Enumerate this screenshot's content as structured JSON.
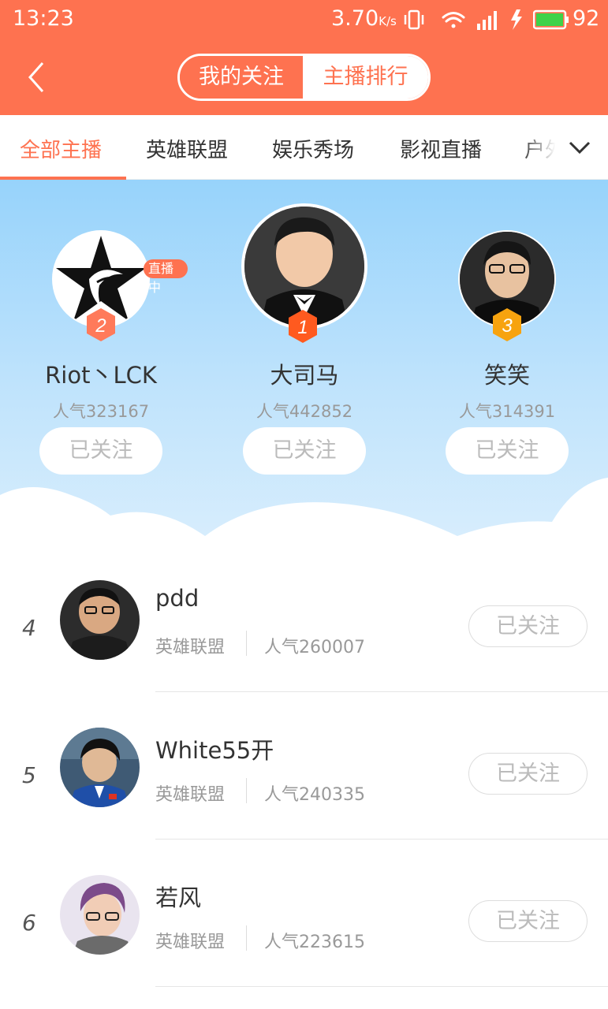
{
  "status_bar": {
    "time": "13:23",
    "speed": "3.70",
    "speed_unit": "K/s",
    "battery": "92"
  },
  "header": {
    "tabs": [
      "我的关注",
      "主播排行"
    ],
    "active_tab": "主播排行"
  },
  "categories": {
    "items": [
      "全部主播",
      "英雄联盟",
      "娱乐秀场",
      "影视直播",
      "户外"
    ],
    "active_index": 0
  },
  "top3": [
    {
      "rank": "2",
      "name": "Riot丶LCK",
      "popularity": "人气323167",
      "follow_label": "已关注",
      "live_label": "直播中"
    },
    {
      "rank": "1",
      "name": "大司马",
      "popularity": "人气442852",
      "follow_label": "已关注"
    },
    {
      "rank": "3",
      "name": "笑笑",
      "popularity": "人气314391",
      "follow_label": "已关注"
    }
  ],
  "ranking": [
    {
      "rank": "4",
      "name": "pdd",
      "category": "英雄联盟",
      "popularity": "人气260007",
      "follow_label": "已关注"
    },
    {
      "rank": "5",
      "name": "White55开",
      "category": "英雄联盟",
      "popularity": "人气240335",
      "follow_label": "已关注"
    },
    {
      "rank": "6",
      "name": "若风",
      "category": "英雄联盟",
      "popularity": "人气223615",
      "follow_label": "已关注"
    }
  ],
  "colors": {
    "accent": "#fe7250",
    "rank1": "#ff5a1f",
    "rank2": "#ff7a5a",
    "rank3": "#f7a30f"
  }
}
